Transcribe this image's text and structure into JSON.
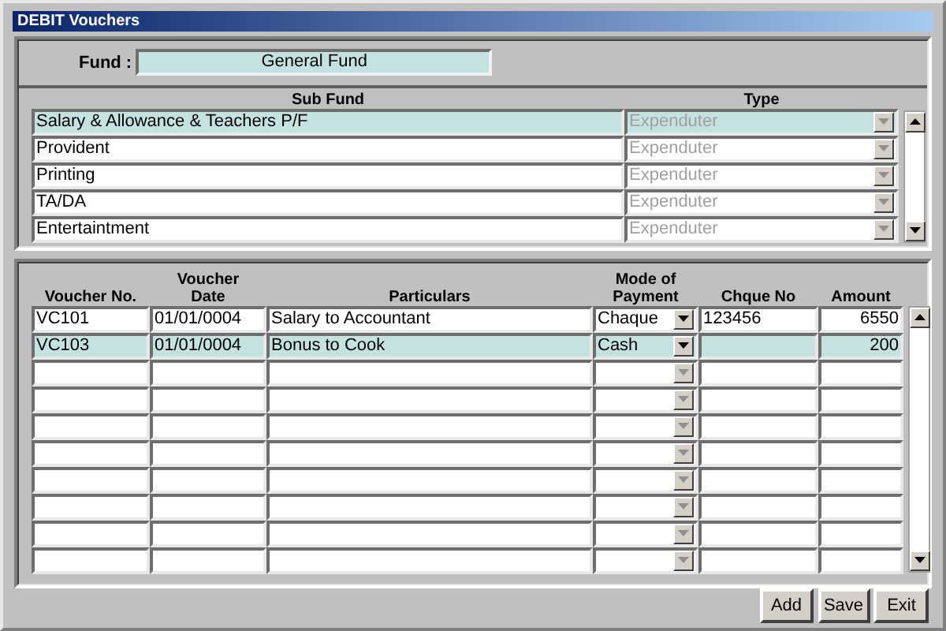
{
  "window": {
    "title": "DEBIT Vouchers"
  },
  "fund": {
    "label": "Fund :",
    "value": "General Fund"
  },
  "sub_funds": {
    "columns": [
      "Sub Fund",
      "Type"
    ],
    "rows": [
      {
        "name": "Salary & Allowance & Teachers P/F",
        "type": "Expenduter",
        "selected": true
      },
      {
        "name": "Provident",
        "type": "Expenduter",
        "selected": false
      },
      {
        "name": "Printing",
        "type": "Expenduter",
        "selected": false
      },
      {
        "name": "TA/DA",
        "type": "Expenduter",
        "selected": false
      },
      {
        "name": "Entertaintment",
        "type": "Expenduter",
        "selected": false
      }
    ]
  },
  "vouchers": {
    "columns": [
      "Voucher No.",
      "Voucher Date",
      "Particulars",
      "Mode of Payment",
      "Chque No",
      "Amount"
    ],
    "rows": [
      {
        "voucher_no": "VC101",
        "date": "01/01/0004",
        "particulars": "Salary to Accountant",
        "mode": "Chaque",
        "cheque_no": "123456",
        "amount": "6550",
        "selected": false,
        "disabled": false
      },
      {
        "voucher_no": "VC103",
        "date": "01/01/0004",
        "particulars": "Bonus to Cook",
        "mode": "Cash",
        "amount": "200",
        "selected": true,
        "disabled": false
      },
      {
        "selected": false,
        "disabled": true
      },
      {
        "selected": false,
        "disabled": true
      },
      {
        "selected": false,
        "disabled": true
      },
      {
        "selected": false,
        "disabled": true
      },
      {
        "selected": false,
        "disabled": true
      },
      {
        "selected": false,
        "disabled": true
      },
      {
        "selected": false,
        "disabled": true
      },
      {
        "selected": false,
        "disabled": true
      }
    ]
  },
  "buttons": [
    "Add",
    "Save",
    "Exit"
  ]
}
